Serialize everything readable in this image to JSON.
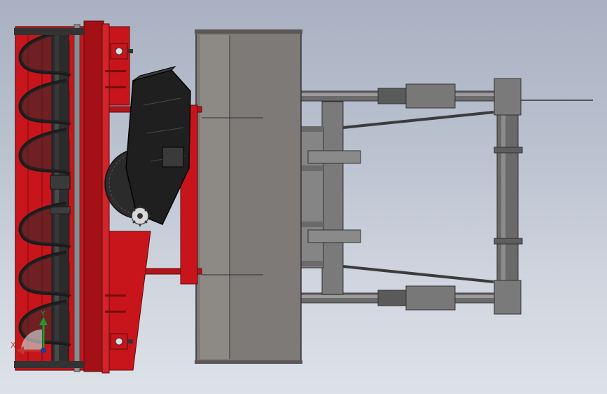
{
  "viewport": {
    "background_top": "#a9b1c2",
    "background_bottom": "#dde1e8"
  },
  "colors": {
    "auger_frame": "#c8151b",
    "auger_dark": "#7a0b0e",
    "flighting": "#2a2a2a",
    "chute": "#1f1f1f",
    "bucket": "#7d7a77",
    "bucket_dark": "#5a5754",
    "arm": "#6d6d6d",
    "arm_light": "#9a9a9a"
  },
  "triad": {
    "x_label": "X",
    "y_label": "Y",
    "x_icon": "x-axis-arrow",
    "y_icon": "y-axis-arrow"
  }
}
